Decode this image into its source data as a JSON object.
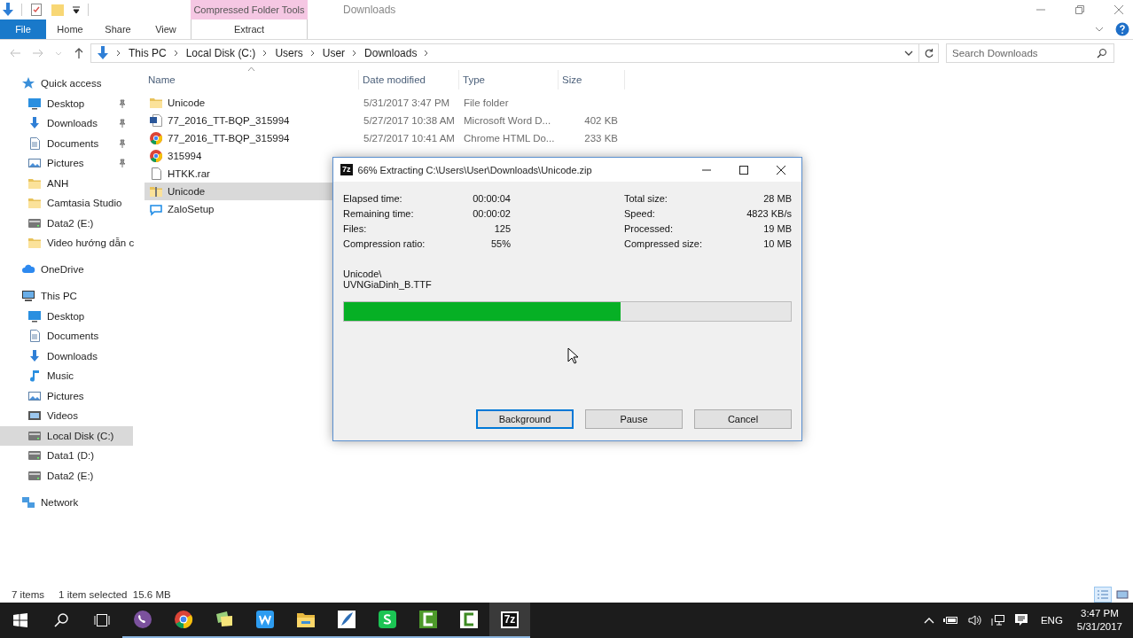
{
  "ribbon": {
    "contextual_group": "Compressed Folder Tools",
    "window_title": "Downloads",
    "tabs": [
      {
        "label": "File",
        "kind": "file",
        "selected": false
      },
      {
        "label": "Home",
        "kind": "plain",
        "selected": false
      },
      {
        "label": "Share",
        "kind": "plain",
        "selected": false
      },
      {
        "label": "View",
        "kind": "plain",
        "selected": false
      }
    ],
    "contextual_tab": {
      "label": "Extract",
      "selected": true
    }
  },
  "address_bar": {
    "crumbs": [
      "This PC",
      "Local Disk (C:)",
      "Users",
      "User",
      "Downloads"
    ]
  },
  "search": {
    "placeholder": "Search Downloads"
  },
  "navigation": [
    {
      "label": "Quick access",
      "kind": "star",
      "selected": false,
      "children": [
        {
          "label": "Desktop",
          "kind": "desktop",
          "pinned": true,
          "selected": false
        },
        {
          "label": "Downloads",
          "kind": "downloads",
          "pinned": true,
          "selected": false
        },
        {
          "label": "Documents",
          "kind": "documents",
          "pinned": true,
          "selected": false
        },
        {
          "label": "Pictures",
          "kind": "pictures",
          "pinned": true,
          "selected": false
        },
        {
          "label": "ANH",
          "kind": "folder",
          "pinned": false,
          "selected": false
        },
        {
          "label": "Camtasia Studio",
          "kind": "folder",
          "pinned": false,
          "selected": false
        },
        {
          "label": "Data2 (E:)",
          "kind": "drive",
          "pinned": false,
          "selected": false
        },
        {
          "label": "Video hướng dẫn c",
          "kind": "folder",
          "pinned": false,
          "selected": false
        }
      ]
    },
    {
      "label": "OneDrive",
      "kind": "cloud",
      "selected": false
    },
    {
      "label": "This PC",
      "kind": "pc",
      "selected": false,
      "children": [
        {
          "label": "Desktop",
          "kind": "desktop",
          "pinned": false,
          "selected": false
        },
        {
          "label": "Documents",
          "kind": "documents",
          "pinned": false,
          "selected": false
        },
        {
          "label": "Downloads",
          "kind": "downloads",
          "pinned": false,
          "selected": false
        },
        {
          "label": "Music",
          "kind": "music",
          "pinned": false,
          "selected": false
        },
        {
          "label": "Pictures",
          "kind": "pictures",
          "pinned": false,
          "selected": false
        },
        {
          "label": "Videos",
          "kind": "videos",
          "pinned": false,
          "selected": false
        },
        {
          "label": "Local Disk (C:)",
          "kind": "drive",
          "pinned": false,
          "selected": true
        },
        {
          "label": "Data1 (D:)",
          "kind": "drive",
          "pinned": false,
          "selected": false
        },
        {
          "label": "Data2 (E:)",
          "kind": "drive",
          "pinned": false,
          "selected": false
        }
      ]
    },
    {
      "label": "Network",
      "kind": "network",
      "selected": false
    }
  ],
  "columns": [
    "Name",
    "Date modified",
    "Type",
    "Size"
  ],
  "files": [
    {
      "name": "Unicode",
      "kind": "folder",
      "date": "5/31/2017 3:47 PM",
      "type": "File folder",
      "selected": false
    },
    {
      "name": "77_2016_TT-BQP_315994",
      "kind": "word",
      "date": "5/27/2017 10:38 AM",
      "type": "Microsoft Word D...",
      "size": "402 KB",
      "selected": false
    },
    {
      "name": "77_2016_TT-BQP_315994",
      "kind": "chrome",
      "date": "5/27/2017 10:41 AM",
      "type": "Chrome HTML Do...",
      "size": "233 KB",
      "selected": false
    },
    {
      "name": "315994",
      "kind": "chrome",
      "selected": false
    },
    {
      "name": "HTKK.rar",
      "kind": "rar",
      "selected": false
    },
    {
      "name": "Unicode",
      "kind": "zip",
      "selected": true
    },
    {
      "name": "ZaloSetup",
      "kind": "zalo",
      "selected": false
    }
  ],
  "status_bar": {
    "count": "7 items",
    "selection": "1 item selected  15.6 MB",
    "view_buttons": [
      {
        "kind": "details",
        "selected": true
      },
      {
        "kind": "icons",
        "selected": false
      }
    ]
  },
  "dialog": {
    "icon_text": "7z",
    "title": "66% Extracting C:\\Users\\User\\Downloads\\Unicode.zip",
    "stats_left": [
      {
        "label": "Elapsed time:",
        "value": "00:00:04"
      },
      {
        "label": "Remaining time:",
        "value": "00:00:02"
      },
      {
        "label": "Files:",
        "value": "125"
      },
      {
        "label": "Compression ratio:",
        "value": "55%"
      }
    ],
    "stats_right": [
      {
        "label": "Total size:",
        "value": "28 MB"
      },
      {
        "label": "Speed:",
        "value": "4823 KB/s"
      },
      {
        "label": "Processed:",
        "value": "19 MB"
      },
      {
        "label": "Compressed size:",
        "value": "10 MB"
      }
    ],
    "current_file": [
      "Unicode\\",
      "UVNGiaDinh_B.TTF"
    ],
    "progress": {
      "level": 0.62
    },
    "buttons": [
      {
        "label": "Background",
        "default": true
      },
      {
        "label": "Pause",
        "default": false
      },
      {
        "label": "Cancel",
        "default": false
      }
    ]
  },
  "taskbar": {
    "apps": [
      {
        "kind": "viber",
        "running": true,
        "active": false
      },
      {
        "kind": "chrome",
        "running": true,
        "active": false
      },
      {
        "kind": "sticky",
        "running": true,
        "active": false
      },
      {
        "kind": "writer",
        "running": true,
        "active": false
      },
      {
        "kind": "explorer",
        "running": true,
        "active": false
      },
      {
        "kind": "quill",
        "running": true,
        "active": false
      },
      {
        "kind": "sheet",
        "running": true,
        "active": false
      },
      {
        "kind": "camgreen",
        "running": true,
        "active": false
      },
      {
        "kind": "camwhite",
        "running": true,
        "active": false
      },
      {
        "kind": "sevenzip",
        "label": "7z",
        "running": true,
        "active": true
      }
    ],
    "language": "ENG",
    "time": "3:47 PM",
    "date": "5/31/2017"
  }
}
